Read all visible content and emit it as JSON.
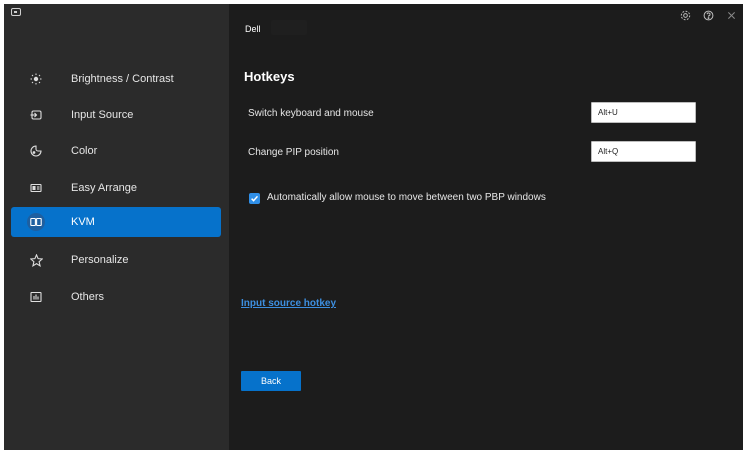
{
  "header": {
    "monitor_name": "Dell"
  },
  "sidebar": {
    "items": [
      {
        "label": "Brightness / Contrast",
        "icon": "brightness-icon",
        "active": false
      },
      {
        "label": "Input Source",
        "icon": "input-source-icon",
        "active": false
      },
      {
        "label": "Color",
        "icon": "color-palette-icon",
        "active": false
      },
      {
        "label": "Easy Arrange",
        "icon": "easy-arrange-icon",
        "active": false
      },
      {
        "label": "KVM",
        "icon": "kvm-icon",
        "active": true
      },
      {
        "label": "Personalize",
        "icon": "star-icon",
        "active": false
      },
      {
        "label": "Others",
        "icon": "others-icon",
        "active": false
      }
    ]
  },
  "main": {
    "title": "Hotkeys",
    "rows": [
      {
        "label": "Switch keyboard and mouse",
        "value": "Alt+U"
      },
      {
        "label": "Change PIP position",
        "value": "Alt+Q"
      }
    ],
    "checkbox": {
      "label": "Automatically allow mouse to move between two PBP windows",
      "checked": true
    },
    "link": "Input source hotkey",
    "back_button": "Back"
  },
  "colors": {
    "accent": "#0672cb",
    "sidebar_bg": "#2b2b2b",
    "main_bg": "#1c1c1c",
    "link": "#3d8fe0"
  }
}
